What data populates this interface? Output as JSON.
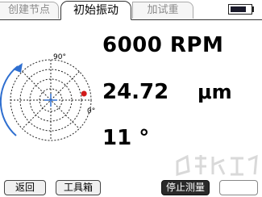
{
  "tabs": [
    {
      "label": "创建节点",
      "active": false
    },
    {
      "label": "初始振动",
      "active": true
    },
    {
      "label": "加试重",
      "active": false
    }
  ],
  "battery": {
    "level": 0.8
  },
  "readouts": {
    "speed": "6000 RPM",
    "amplitude_value": "24.72",
    "amplitude_unit": "μm",
    "phase": "11 °"
  },
  "polar_plot": {
    "labels": {
      "top": "90°",
      "right": "0°"
    },
    "marker_angle_deg": 11,
    "marker_color": "#d11a1a"
  },
  "buttons": {
    "back": "返回",
    "toolbox": "工具箱",
    "stop": "停止测量"
  },
  "colors": {
    "accent_blue": "#2f6fd0",
    "marker_red": "#d11a1a"
  }
}
